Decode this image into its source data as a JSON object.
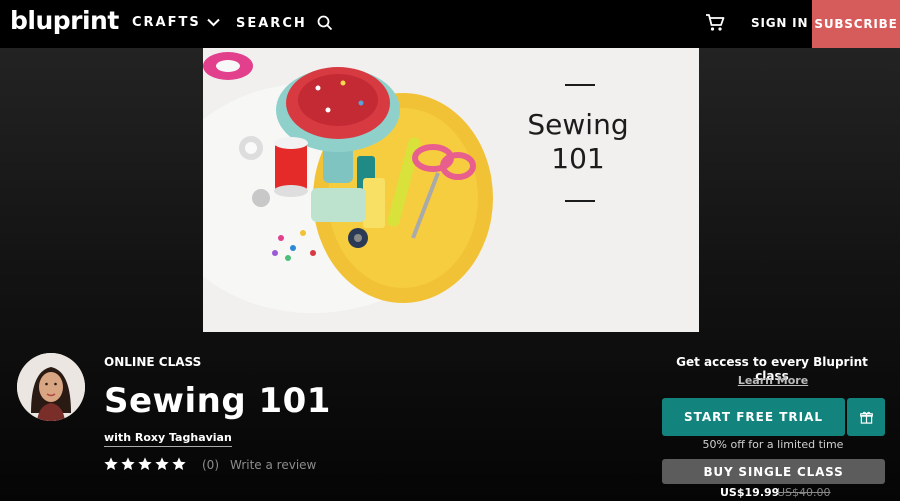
{
  "header": {
    "logo": "bluprint",
    "nav": {
      "crafts": "CRAFTS",
      "search": "SEARCH"
    },
    "cart_icon": "cart-icon",
    "signin": "SIGN IN",
    "subscribe": "SUBSCRIBE",
    "colors": {
      "subscribe_bg": "#d65c5c",
      "bar_bg": "#000000"
    }
  },
  "hero": {
    "title_line1": "Sewing",
    "title_line2": "101"
  },
  "class_info": {
    "kicker": "ONLINE CLASS",
    "title": "Sewing 101",
    "instructor": "with Roxy Taghavian",
    "rating_stars": 5,
    "rating_count": "(0)",
    "write_review": "Write a review"
  },
  "cta": {
    "access_text": "Get access to every Bluprint class",
    "learn_more": "Learn More",
    "trial_button": "START FREE TRIAL",
    "gift_icon": "gift-icon",
    "trial_note": "50% off for a limited time",
    "buy_button": "BUY SINGLE CLASS",
    "price": "US$19.99",
    "price_original": "US$40.00",
    "colors": {
      "trial_bg": "#13847d",
      "buy_bg": "#5c5c5c"
    }
  }
}
